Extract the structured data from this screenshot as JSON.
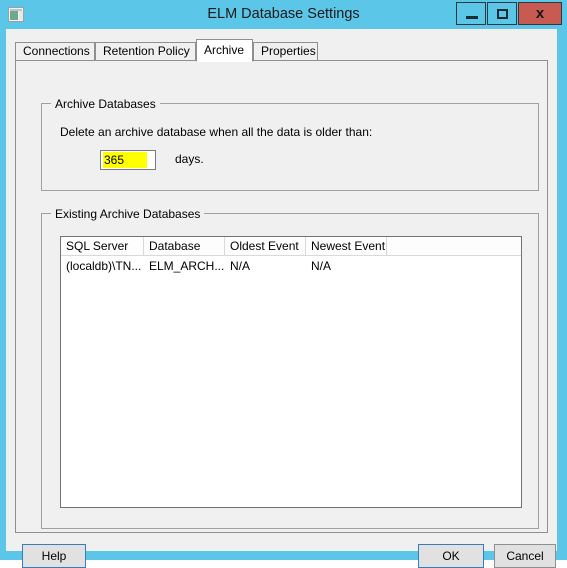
{
  "window": {
    "title": "ELM Database Settings",
    "icon": "database-window-icon",
    "accent_cyan": "#5cc6e8",
    "close_red": "#c75b51",
    "caption_buttons": {
      "minimize": "minimize-icon",
      "maximize": "maximize-icon",
      "close": "×",
      "close_glyph": "x"
    }
  },
  "tabs": [
    {
      "label": "Connections",
      "selected": false
    },
    {
      "label": "Retention Policy",
      "selected": false
    },
    {
      "label": "Archive",
      "selected": true
    },
    {
      "label": "Properties",
      "selected": false
    }
  ],
  "archive_group": {
    "title": "Archive Databases",
    "description": "Delete an archive database when all the data is older than:",
    "days_value": "365",
    "days_placeholder": "0",
    "days_unit": "days.",
    "selection_highlight": "#ffff00"
  },
  "existing_group": {
    "title": "Existing Archive Databases",
    "columns": [
      "SQL Server",
      "Database",
      "Oldest Event",
      "Newest Event",
      ""
    ],
    "rows": [
      [
        "(localdb)\\TN...",
        "ELM_ARCH...",
        "N/A",
        "N/A",
        ""
      ]
    ]
  },
  "footer": {
    "help_label": "Help",
    "ok_label": "OK",
    "cancel_label": "Cancel"
  }
}
